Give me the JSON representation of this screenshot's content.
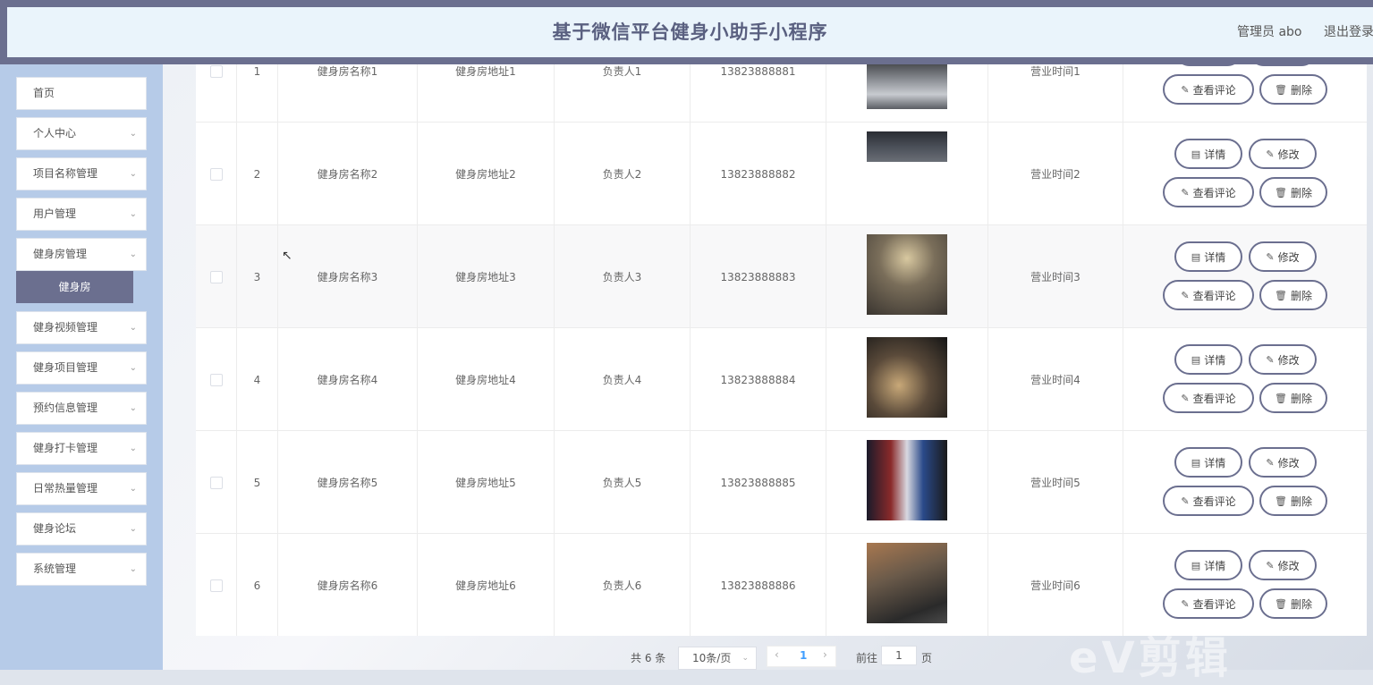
{
  "header": {
    "title": "基于微信平台健身小助手小程序",
    "user": "管理员 abo",
    "logout": "退出登录"
  },
  "sidebar": {
    "items": [
      {
        "label": "首页",
        "has_arrow": false
      },
      {
        "label": "个人中心",
        "has_arrow": true
      },
      {
        "label": "项目名称管理",
        "has_arrow": true
      },
      {
        "label": "用户管理",
        "has_arrow": true
      },
      {
        "label": "健身房管理",
        "has_arrow": true
      },
      {
        "label": "健身视频管理",
        "has_arrow": true
      },
      {
        "label": "健身项目管理",
        "has_arrow": true
      },
      {
        "label": "预约信息管理",
        "has_arrow": true
      },
      {
        "label": "健身打卡管理",
        "has_arrow": true
      },
      {
        "label": "日常热量管理",
        "has_arrow": true
      },
      {
        "label": "健身论坛",
        "has_arrow": true
      },
      {
        "label": "系统管理",
        "has_arrow": true
      }
    ],
    "active_sub": "健身房"
  },
  "table": {
    "rows": [
      {
        "index": "1",
        "name": "健身房名称1",
        "address": "健身房地址1",
        "manager": "负责人1",
        "phone": "13823888881",
        "hours": "营业时间1"
      },
      {
        "index": "2",
        "name": "健身房名称2",
        "address": "健身房地址2",
        "manager": "负责人2",
        "phone": "13823888882",
        "hours": "营业时间2"
      },
      {
        "index": "3",
        "name": "健身房名称3",
        "address": "健身房地址3",
        "manager": "负责人3",
        "phone": "13823888883",
        "hours": "营业时间3"
      },
      {
        "index": "4",
        "name": "健身房名称4",
        "address": "健身房地址4",
        "manager": "负责人4",
        "phone": "13823888884",
        "hours": "营业时间4"
      },
      {
        "index": "5",
        "name": "健身房名称5",
        "address": "健身房地址5",
        "manager": "负责人5",
        "phone": "13823888885",
        "hours": "营业时间5"
      },
      {
        "index": "6",
        "name": "健身房名称6",
        "address": "健身房地址6",
        "manager": "负责人6",
        "phone": "13823888886",
        "hours": "营业时间6"
      }
    ],
    "actions": {
      "detail": "详情",
      "edit": "修改",
      "comments": "查看评论",
      "delete": "删除"
    }
  },
  "pager": {
    "total": "共 6 条",
    "page_size": "10条/页",
    "current": "1",
    "goto_label": "前往",
    "goto_value": "1",
    "goto_unit": "页"
  },
  "colors": {
    "accent": "#6b6f8f",
    "sidebar_bg": "#b6cbe8",
    "header_bg": "#eaf4fb"
  },
  "watermark": "eV剪辑"
}
